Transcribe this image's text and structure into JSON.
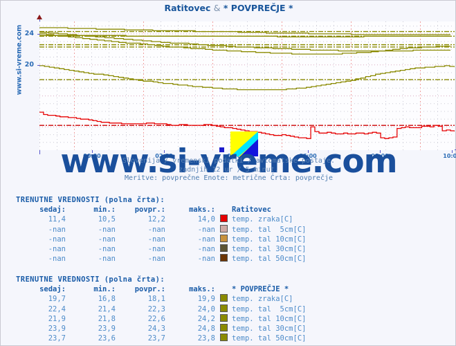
{
  "title": {
    "station": "Ratitovec",
    "amp": "&",
    "average": "* POVPREČJE *"
  },
  "site_label": "www.si-vreme.com",
  "watermark": "www.si-vreme.com",
  "caption": {
    "line1": "Slovenija / vremenski podatki / avtomatske postaje.",
    "line2": "zadnjih 12 ur / 5 minut.",
    "line3": "Meritve: povprečne  Enote: metrične  Črta: povprečje"
  },
  "axis": {
    "y_ticks": [
      "24",
      "20"
    ],
    "x_ticks": [
      "00:00",
      "02:00",
      "04:00",
      "06:00",
      "08:00",
      "10:00"
    ]
  },
  "table1": {
    "heading": "TRENUTNE VREDNOSTI (polna črta):",
    "columns": [
      "sedaj:",
      "min.:",
      "povpr.:",
      "maks.:"
    ],
    "series_title": "Ratitovec",
    "rows": [
      {
        "sedaj": "11,4",
        "min": "10,5",
        "povpr": "12,2",
        "maks": "14,0",
        "color": "#e60000",
        "label": "temp. zraka[C]"
      },
      {
        "sedaj": "-nan",
        "min": "-nan",
        "povpr": "-nan",
        "maks": "-nan",
        "color": "#ceaaa5",
        "label": "temp. tal  5cm[C]"
      },
      {
        "sedaj": "-nan",
        "min": "-nan",
        "povpr": "-nan",
        "maks": "-nan",
        "color": "#c8913b",
        "label": "temp. tal 10cm[C]"
      },
      {
        "sedaj": "-nan",
        "min": "-nan",
        "povpr": "-nan",
        "maks": "-nan",
        "color": "#5c5433",
        "label": "temp. tal 30cm[C]"
      },
      {
        "sedaj": "-nan",
        "min": "-nan",
        "povpr": "-nan",
        "maks": "-nan",
        "color": "#6b3505",
        "label": "temp. tal 50cm[C]"
      }
    ]
  },
  "table2": {
    "heading": "TRENUTNE VREDNOSTI (polna črta):",
    "columns": [
      "sedaj:",
      "min.:",
      "povpr.:",
      "maks.:"
    ],
    "series_title": "* POVPREČJE *",
    "rows": [
      {
        "sedaj": "19,7",
        "min": "16,8",
        "povpr": "18,1",
        "maks": "19,9",
        "color": "#8a8a00",
        "label": "temp. zraka[C]"
      },
      {
        "sedaj": "22,4",
        "min": "21,4",
        "povpr": "22,3",
        "maks": "24,0",
        "color": "#8a8a00",
        "label": "temp. tal  5cm[C]"
      },
      {
        "sedaj": "21,9",
        "min": "21,8",
        "povpr": "22,6",
        "maks": "24,2",
        "color": "#8a8a00",
        "label": "temp. tal 10cm[C]"
      },
      {
        "sedaj": "23,9",
        "min": "23,9",
        "povpr": "24,3",
        "maks": "24,8",
        "color": "#8a8a00",
        "label": "temp. tal 30cm[C]"
      },
      {
        "sedaj": "23,7",
        "min": "23,6",
        "povpr": "23,7",
        "maks": "23,8",
        "color": "#8a8a00",
        "label": "temp. tal 50cm[C]"
      }
    ]
  },
  "chart_data": {
    "type": "line",
    "title": "Ratitovec & * POVPREČJE *",
    "xlabel": "",
    "ylabel": "",
    "x_tick_labels": [
      "00:00",
      "02:00",
      "04:00",
      "06:00",
      "08:00",
      "10:00"
    ],
    "y_tick_labels": [
      "24",
      "20"
    ],
    "ylim": [
      9.0,
      25.6
    ],
    "grid": true,
    "legend": "below-chart-tables",
    "series": [
      {
        "name": "Ratitovec temp. zraka[C]",
        "color": "#e60000",
        "style": "solid",
        "avg": 12.2,
        "min": 10.5,
        "max": 14.0,
        "now": 11.4,
        "values": [
          13.9,
          13.6,
          13.5,
          13.5,
          13.4,
          13.3,
          13.3,
          13.2,
          13.2,
          13.1,
          13.0,
          13.0,
          12.9,
          12.8,
          12.7,
          12.6,
          12.6,
          12.5,
          12.5,
          12.5,
          12.4,
          12.4,
          12.4,
          12.4,
          12.4,
          12.4,
          12.5,
          12.5,
          12.4,
          12.4,
          12.4,
          12.3,
          12.2,
          12.2,
          12.3,
          12.3,
          12.2,
          12.2,
          12.2,
          12.2,
          12.3,
          12.3,
          12.2,
          12.1,
          12.0,
          11.9,
          11.9,
          11.8,
          11.7,
          11.6,
          11.5,
          11.4,
          11.4,
          11.3,
          11.2,
          11.1,
          11.0,
          10.9,
          10.9,
          11.0,
          10.9,
          10.8,
          10.7,
          10.6,
          10.6,
          10.5,
          12.0,
          11.4,
          11.2,
          11.2,
          11.3,
          11.2,
          11.1,
          11.1,
          11.2,
          11.1,
          11.1,
          11.2,
          11.2,
          11.1,
          11.2,
          11.3,
          11.2,
          10.6,
          10.5,
          10.6,
          10.7,
          11.8,
          11.9,
          12.0,
          11.9,
          11.9,
          11.9,
          12.1,
          12.1,
          12.0,
          12.2,
          12.1,
          11.5,
          11.6,
          11.5,
          11.4
        ]
      },
      {
        "name": "Ratitovec povprečje (črtkana)",
        "color": "#cc0000",
        "style": "dash-dot",
        "value": 12.2
      },
      {
        "name": "* POVPREČJE * temp. zraka[C]",
        "color": "#8a8a00",
        "style": "solid",
        "avg": 18.1,
        "min": 16.8,
        "max": 19.9,
        "now": 19.7,
        "values": [
          19.9,
          19.8,
          19.7,
          19.6,
          19.5,
          19.4,
          19.3,
          19.2,
          19.1,
          19.0,
          18.9,
          18.8,
          18.8,
          18.7,
          18.6,
          18.5,
          18.4,
          18.3,
          18.2,
          18.1,
          18.0,
          17.9,
          17.9,
          17.8,
          17.7,
          17.6,
          17.6,
          17.5,
          17.4,
          17.4,
          17.3,
          17.2,
          17.2,
          17.1,
          17.1,
          17.0,
          17.0,
          16.9,
          16.9,
          16.9,
          16.8,
          16.8,
          16.8,
          16.8,
          16.8,
          16.8,
          16.8,
          16.8,
          16.8,
          16.8,
          16.9,
          16.9,
          17.0,
          17.0,
          17.1,
          17.2,
          17.3,
          17.4,
          17.5,
          17.6,
          17.7,
          17.8,
          17.9,
          18.0,
          18.2,
          18.3,
          18.5,
          18.6,
          18.8,
          18.9,
          19.0,
          19.1,
          19.2,
          19.3,
          19.4,
          19.5,
          19.6,
          19.6,
          19.7,
          19.7,
          19.8,
          19.8,
          19.9,
          19.8,
          19.7
        ]
      },
      {
        "name": "* POVPREČJE * temp. tal  5cm[C]",
        "color": "#8a8a00",
        "style": "solid",
        "avg": 22.3,
        "min": 21.4,
        "max": 24.0,
        "now": 22.4,
        "values": [
          24.0,
          23.9,
          23.8,
          23.7,
          23.6,
          23.5,
          23.4,
          23.3,
          23.2,
          23.1,
          23.0,
          22.9,
          22.8,
          22.8,
          22.7,
          22.6,
          22.5,
          22.4,
          22.3,
          22.3,
          22.2,
          22.1,
          22.1,
          22.0,
          21.9,
          21.9,
          21.8,
          21.8,
          21.7,
          21.7,
          21.6,
          21.6,
          21.5,
          21.5,
          21.5,
          21.4,
          21.4,
          21.4,
          21.4,
          21.4,
          21.4,
          21.4,
          21.5,
          21.5,
          21.6,
          21.6,
          21.7,
          21.8,
          21.9,
          22.0,
          22.1,
          22.2,
          22.2,
          22.3,
          22.3,
          22.4,
          22.4,
          22.4
        ]
      },
      {
        "name": "* POVPREČJE * temp. tal 10cm[C]",
        "color": "#8a8a00",
        "style": "solid",
        "avg": 22.6,
        "min": 21.8,
        "max": 24.2,
        "now": 21.9,
        "values": [
          24.2,
          24.1,
          24.0,
          23.9,
          23.8,
          23.7,
          23.6,
          23.5,
          23.4,
          23.3,
          23.2,
          23.1,
          23.0,
          22.9,
          22.8,
          22.8,
          22.7,
          22.6,
          22.5,
          22.5,
          22.4,
          22.3,
          22.3,
          22.2,
          22.2,
          22.1,
          22.1,
          22.0,
          22.0,
          21.9,
          21.9,
          21.9,
          21.8,
          21.8,
          21.8,
          21.8,
          21.8,
          21.8,
          21.8,
          21.8,
          21.9,
          21.9,
          21.9,
          21.9,
          21.9
        ]
      },
      {
        "name": "* POVPREČJE * temp. tal 30cm[C]",
        "color": "#8a8a00",
        "style": "solid",
        "avg": 24.3,
        "min": 23.9,
        "max": 24.8,
        "now": 23.9,
        "values": [
          24.8,
          24.8,
          24.7,
          24.7,
          24.6,
          24.6,
          24.5,
          24.5,
          24.4,
          24.4,
          24.4,
          24.3,
          24.3,
          24.3,
          24.2,
          24.2,
          24.1,
          24.1,
          24.1,
          24.0,
          24.0,
          24.0,
          23.9,
          23.9,
          23.9,
          23.9,
          23.9,
          23.9,
          23.9,
          23.9
        ]
      },
      {
        "name": "* POVPREČJE * temp. tal 50cm[C]",
        "color": "#8a8a00",
        "style": "solid",
        "avg": 23.7,
        "min": 23.6,
        "max": 23.8,
        "now": 23.7,
        "values": [
          23.8,
          23.8,
          23.8,
          23.8,
          23.7,
          23.7,
          23.7,
          23.7,
          23.7,
          23.7,
          23.7,
          23.6,
          23.6,
          23.6,
          23.6,
          23.7,
          23.7,
          23.7,
          23.7,
          23.7
        ]
      }
    ],
    "average_lines": [
      {
        "name": "avg Ratitovec zraka",
        "value": 12.2,
        "color": "#cc0000",
        "style": "dash-dot"
      },
      {
        "name": "avg POVPREČJE zraka",
        "value": 18.1,
        "color": "#8a8a00",
        "style": "dash-dot"
      },
      {
        "name": "avg POVPREČJE tal 5cm",
        "value": 22.3,
        "color": "#8a8a00",
        "style": "dash-dot"
      },
      {
        "name": "avg POVPREČJE tal 10cm",
        "value": 22.6,
        "color": "#8a8a00",
        "style": "dash-dot"
      },
      {
        "name": "avg POVPREČJE tal 30cm",
        "value": 24.3,
        "color": "#8a8a00",
        "style": "dash-dot"
      },
      {
        "name": "avg POVPREČJE tal 50cm",
        "value": 23.7,
        "color": "#8a8a00",
        "style": "dash-dot"
      }
    ]
  }
}
